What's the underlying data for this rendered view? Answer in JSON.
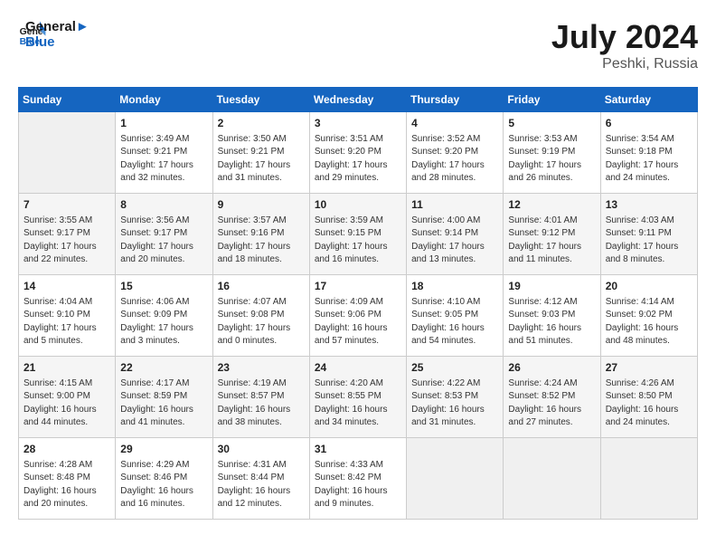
{
  "header": {
    "logo_line1": "General",
    "logo_line2": "Blue",
    "month": "July 2024",
    "location": "Peshki, Russia"
  },
  "weekdays": [
    "Sunday",
    "Monday",
    "Tuesday",
    "Wednesday",
    "Thursday",
    "Friday",
    "Saturday"
  ],
  "weeks": [
    [
      {
        "day": "",
        "detail": ""
      },
      {
        "day": "1",
        "detail": "Sunrise: 3:49 AM\nSunset: 9:21 PM\nDaylight: 17 hours\nand 32 minutes."
      },
      {
        "day": "2",
        "detail": "Sunrise: 3:50 AM\nSunset: 9:21 PM\nDaylight: 17 hours\nand 31 minutes."
      },
      {
        "day": "3",
        "detail": "Sunrise: 3:51 AM\nSunset: 9:20 PM\nDaylight: 17 hours\nand 29 minutes."
      },
      {
        "day": "4",
        "detail": "Sunrise: 3:52 AM\nSunset: 9:20 PM\nDaylight: 17 hours\nand 28 minutes."
      },
      {
        "day": "5",
        "detail": "Sunrise: 3:53 AM\nSunset: 9:19 PM\nDaylight: 17 hours\nand 26 minutes."
      },
      {
        "day": "6",
        "detail": "Sunrise: 3:54 AM\nSunset: 9:18 PM\nDaylight: 17 hours\nand 24 minutes."
      }
    ],
    [
      {
        "day": "7",
        "detail": "Sunrise: 3:55 AM\nSunset: 9:17 PM\nDaylight: 17 hours\nand 22 minutes."
      },
      {
        "day": "8",
        "detail": "Sunrise: 3:56 AM\nSunset: 9:17 PM\nDaylight: 17 hours\nand 20 minutes."
      },
      {
        "day": "9",
        "detail": "Sunrise: 3:57 AM\nSunset: 9:16 PM\nDaylight: 17 hours\nand 18 minutes."
      },
      {
        "day": "10",
        "detail": "Sunrise: 3:59 AM\nSunset: 9:15 PM\nDaylight: 17 hours\nand 16 minutes."
      },
      {
        "day": "11",
        "detail": "Sunrise: 4:00 AM\nSunset: 9:14 PM\nDaylight: 17 hours\nand 13 minutes."
      },
      {
        "day": "12",
        "detail": "Sunrise: 4:01 AM\nSunset: 9:12 PM\nDaylight: 17 hours\nand 11 minutes."
      },
      {
        "day": "13",
        "detail": "Sunrise: 4:03 AM\nSunset: 9:11 PM\nDaylight: 17 hours\nand 8 minutes."
      }
    ],
    [
      {
        "day": "14",
        "detail": "Sunrise: 4:04 AM\nSunset: 9:10 PM\nDaylight: 17 hours\nand 5 minutes."
      },
      {
        "day": "15",
        "detail": "Sunrise: 4:06 AM\nSunset: 9:09 PM\nDaylight: 17 hours\nand 3 minutes."
      },
      {
        "day": "16",
        "detail": "Sunrise: 4:07 AM\nSunset: 9:08 PM\nDaylight: 17 hours\nand 0 minutes."
      },
      {
        "day": "17",
        "detail": "Sunrise: 4:09 AM\nSunset: 9:06 PM\nDaylight: 16 hours\nand 57 minutes."
      },
      {
        "day": "18",
        "detail": "Sunrise: 4:10 AM\nSunset: 9:05 PM\nDaylight: 16 hours\nand 54 minutes."
      },
      {
        "day": "19",
        "detail": "Sunrise: 4:12 AM\nSunset: 9:03 PM\nDaylight: 16 hours\nand 51 minutes."
      },
      {
        "day": "20",
        "detail": "Sunrise: 4:14 AM\nSunset: 9:02 PM\nDaylight: 16 hours\nand 48 minutes."
      }
    ],
    [
      {
        "day": "21",
        "detail": "Sunrise: 4:15 AM\nSunset: 9:00 PM\nDaylight: 16 hours\nand 44 minutes."
      },
      {
        "day": "22",
        "detail": "Sunrise: 4:17 AM\nSunset: 8:59 PM\nDaylight: 16 hours\nand 41 minutes."
      },
      {
        "day": "23",
        "detail": "Sunrise: 4:19 AM\nSunset: 8:57 PM\nDaylight: 16 hours\nand 38 minutes."
      },
      {
        "day": "24",
        "detail": "Sunrise: 4:20 AM\nSunset: 8:55 PM\nDaylight: 16 hours\nand 34 minutes."
      },
      {
        "day": "25",
        "detail": "Sunrise: 4:22 AM\nSunset: 8:53 PM\nDaylight: 16 hours\nand 31 minutes."
      },
      {
        "day": "26",
        "detail": "Sunrise: 4:24 AM\nSunset: 8:52 PM\nDaylight: 16 hours\nand 27 minutes."
      },
      {
        "day": "27",
        "detail": "Sunrise: 4:26 AM\nSunset: 8:50 PM\nDaylight: 16 hours\nand 24 minutes."
      }
    ],
    [
      {
        "day": "28",
        "detail": "Sunrise: 4:28 AM\nSunset: 8:48 PM\nDaylight: 16 hours\nand 20 minutes."
      },
      {
        "day": "29",
        "detail": "Sunrise: 4:29 AM\nSunset: 8:46 PM\nDaylight: 16 hours\nand 16 minutes."
      },
      {
        "day": "30",
        "detail": "Sunrise: 4:31 AM\nSunset: 8:44 PM\nDaylight: 16 hours\nand 12 minutes."
      },
      {
        "day": "31",
        "detail": "Sunrise: 4:33 AM\nSunset: 8:42 PM\nDaylight: 16 hours\nand 9 minutes."
      },
      {
        "day": "",
        "detail": ""
      },
      {
        "day": "",
        "detail": ""
      },
      {
        "day": "",
        "detail": ""
      }
    ]
  ]
}
